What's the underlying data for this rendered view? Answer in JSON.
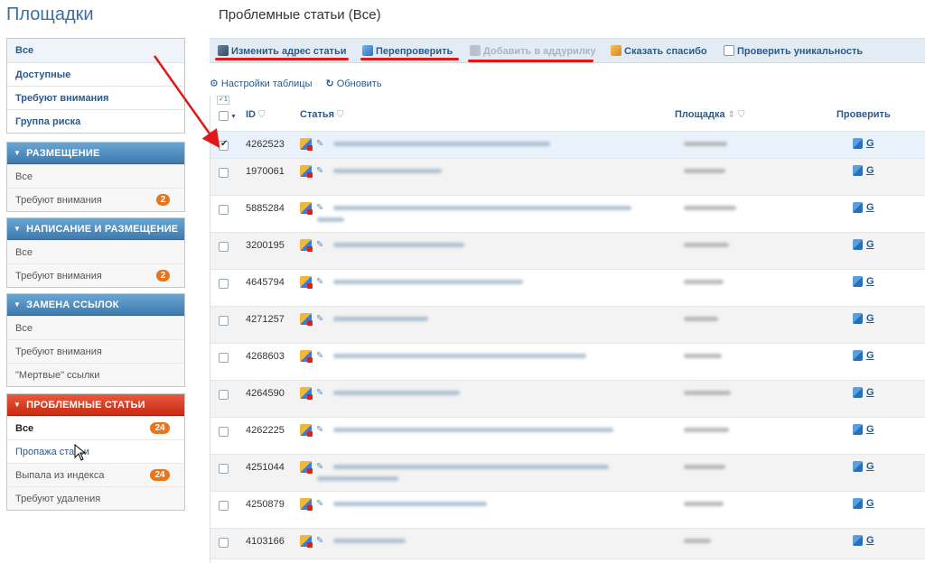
{
  "sidebar": {
    "brand": "Площадки",
    "top_items": [
      {
        "label": "Все"
      },
      {
        "label": "Доступные"
      },
      {
        "label": "Требуют внимания"
      },
      {
        "label": "Группа риска"
      }
    ],
    "groups": [
      {
        "title": "РАЗМЕЩЕНИЕ",
        "items": [
          {
            "label": "Все"
          },
          {
            "label": "Требуют внимания",
            "badge": "2"
          }
        ]
      },
      {
        "title": "НАПИСАНИЕ И РАЗМЕЩЕНИЕ",
        "items": [
          {
            "label": "Все"
          },
          {
            "label": "Требуют внимания",
            "badge": "2"
          }
        ]
      },
      {
        "title": "ЗАМЕНА ССЫЛОК",
        "items": [
          {
            "label": "Все"
          },
          {
            "label": "Требуют внимания"
          },
          {
            "label": "\"Мертвые\" ссылки"
          }
        ]
      },
      {
        "title": "ПРОБЛЕМНЫЕ СТАТЬИ",
        "items": [
          {
            "label": "Все",
            "badge": "24"
          },
          {
            "label": "Пропажа статьи"
          },
          {
            "label": "Выпала из индекса",
            "badge": "24"
          },
          {
            "label": "Требуют удаления"
          }
        ]
      }
    ]
  },
  "main": {
    "title": "Проблемные статьи (Все)",
    "toolbar": {
      "change_url": "Изменить адрес статьи",
      "recheck": "Перепроверить",
      "add_addurl": "Добавить в аддурилку",
      "thanks": "Сказать спасибо",
      "uniqueness": "Проверить уникальность"
    },
    "subtoolbar": {
      "table_settings": "Настройки таблицы",
      "refresh": "Обновить"
    },
    "table": {
      "sort_indicator": "1",
      "columns": {
        "id": "ID",
        "article": "Статья",
        "site": "Площадка",
        "check": "Проверить"
      },
      "check_link": "G",
      "rows": [
        {
          "id": "4262523",
          "checked": true
        },
        {
          "id": "1970061",
          "checked": false
        },
        {
          "id": "5885284",
          "checked": false
        },
        {
          "id": "3200195",
          "checked": false
        },
        {
          "id": "4645794",
          "checked": false
        },
        {
          "id": "4271257",
          "checked": false
        },
        {
          "id": "4268603",
          "checked": false
        },
        {
          "id": "4264590",
          "checked": false
        },
        {
          "id": "4262225",
          "checked": false
        },
        {
          "id": "4251044",
          "checked": false
        },
        {
          "id": "4250879",
          "checked": false
        },
        {
          "id": "4103166",
          "checked": false
        }
      ]
    }
  },
  "colors": {
    "accent": "#2a5b8c",
    "group_header": "#4d8cc2",
    "problem_header": "#d8371c",
    "badge": "#e8751e",
    "annotation": "#e21818"
  }
}
